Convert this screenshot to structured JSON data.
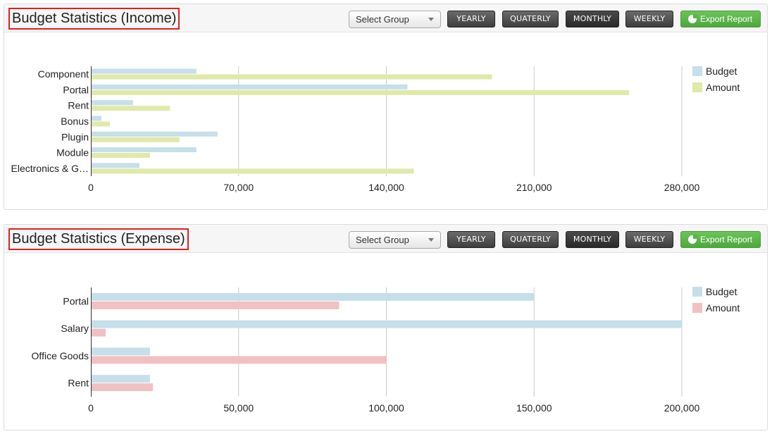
{
  "colors": {
    "budget": "#c6dfea",
    "amount_income": "#e0e9a8",
    "amount_expense": "#f1c0c3",
    "grid": "#cccccc",
    "axis": "#333333"
  },
  "toolbar": {
    "select_placeholder": "Select Group",
    "yearly": "YEARLY",
    "quaterly": "QUATERLY",
    "monthly": "MONTHLY",
    "weekly": "WEEKLY",
    "export": "Export Report",
    "active": "monthly"
  },
  "chart_data": [
    {
      "type": "bar",
      "orientation": "horizontal",
      "title": "Budget Statistics (Income)",
      "categories": [
        "Component",
        "Portal",
        "Rent",
        "Bonus",
        "Plugin",
        "Module",
        "Electronics & G…"
      ],
      "series": [
        {
          "name": "Budget",
          "values": [
            50000,
            150000,
            20000,
            5000,
            60000,
            50000,
            23000
          ]
        },
        {
          "name": "Amount",
          "values": [
            190000,
            255000,
            37500,
            9000,
            42000,
            28000,
            153000
          ]
        }
      ],
      "xlim": [
        0,
        280000
      ],
      "ticks": [
        0,
        70000,
        140000,
        210000,
        280000
      ],
      "tick_labels": [
        "0",
        "70,000",
        "140,000",
        "210,000",
        "280,000"
      ],
      "grid": true,
      "legend": "right"
    },
    {
      "type": "bar",
      "orientation": "horizontal",
      "title": "Budget Statistics (Expense)",
      "categories": [
        "Portal",
        "Salary",
        "Office Goods",
        "Rent"
      ],
      "series": [
        {
          "name": "Budget",
          "values": [
            150000,
            200000,
            20000,
            20000
          ]
        },
        {
          "name": "Amount",
          "values": [
            84000,
            5000,
            100000,
            21000
          ]
        }
      ],
      "xlim": [
        0,
        200000
      ],
      "ticks": [
        0,
        50000,
        100000,
        150000,
        200000
      ],
      "tick_labels": [
        "0",
        "50,000",
        "100,000",
        "150,000",
        "200,000"
      ],
      "grid": true,
      "legend": "right"
    }
  ]
}
